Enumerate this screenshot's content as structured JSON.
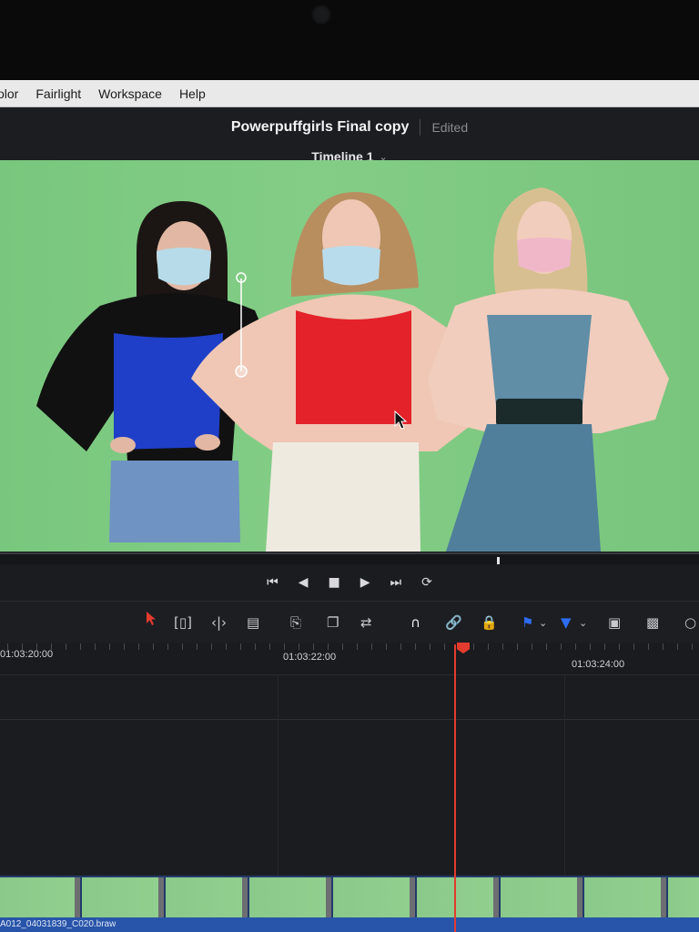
{
  "menu": {
    "items": [
      "olor",
      "Fairlight",
      "Workspace",
      "Help"
    ]
  },
  "project": {
    "title": "Powerpuffgirls Final copy",
    "status": "Edited"
  },
  "timeline": {
    "name": "Timeline 1"
  },
  "ruler": {
    "timecodes": [
      "01:03:20:00",
      "01:03:22:00",
      "01:03:24:00"
    ]
  },
  "clip": {
    "name": "A012_04031839_C020.braw"
  },
  "colors": {
    "green_screen": "#7fc882",
    "playhead": "#e33b2e",
    "clip_band": "#2854a9"
  },
  "transport": {
    "icons": [
      "skip-to-start-icon",
      "play-reverse-icon",
      "stop-icon",
      "play-icon",
      "skip-to-end-icon",
      "loop-icon"
    ]
  },
  "toolbar": {
    "icons": [
      "selection-arrow-icon",
      "trim-edit-icon",
      "dynamic-trim-icon",
      "blade-icon",
      "insert-clip-icon",
      "overwrite-clip-icon",
      "replace-clip-icon",
      "snapping-icon",
      "linked-selection-icon",
      "position-lock-icon",
      "flag-icon",
      "marker-icon",
      "zoom-full-icon",
      "zoom-detail-icon"
    ]
  }
}
